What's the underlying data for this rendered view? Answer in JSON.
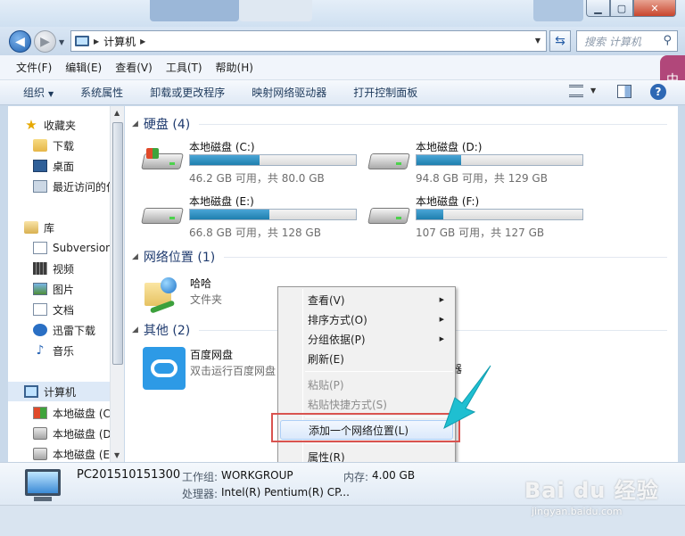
{
  "window": {
    "address_label": "计算机",
    "search_placeholder": "搜索 计算机"
  },
  "menubar": [
    "文件(F)",
    "编辑(E)",
    "查看(V)",
    "工具(T)",
    "帮助(H)"
  ],
  "toolbar": {
    "organize": "组织",
    "items": [
      "系统属性",
      "卸载或更改程序",
      "映射网络驱动器",
      "打开控制面板"
    ]
  },
  "ime_label": "中",
  "navpane": {
    "favorites": "收藏夹",
    "downloads": "下载",
    "desktop": "桌面",
    "recent": "最近访问的位",
    "libraries": "库",
    "subversion": "Subversion",
    "videos": "视频",
    "pictures": "图片",
    "documents": "文档",
    "xunlei": "迅雷下载",
    "music": "音乐",
    "computer": "计算机",
    "drive_c": "本地磁盘 (C",
    "drive_d": "本地磁盘 (D",
    "drive_e": "本地磁盘 (E"
  },
  "sections": {
    "hard_disks": "硬盘 (4)",
    "network": "网络位置 (1)",
    "other": "其他 (2)"
  },
  "drives": [
    {
      "name": "本地磁盘 (C:)",
      "free_text": "46.2 GB 可用，共 80.0 GB",
      "used_fraction": 0.42
    },
    {
      "name": "本地磁盘 (D:)",
      "free_text": "94.8 GB 可用，共 129 GB",
      "used_fraction": 0.27
    },
    {
      "name": "本地磁盘 (E:)",
      "free_text": "66.8 GB 可用，共 128 GB",
      "used_fraction": 0.48
    },
    {
      "name": "本地磁盘 (F:)",
      "free_text": "107 GB 可用，共 127 GB",
      "used_fraction": 0.16
    }
  ],
  "network_item": {
    "name": "哈哈",
    "type": "文件夹"
  },
  "other_item": {
    "name": "百度网盘",
    "desc": "双击运行百度网盘",
    "partial_text": "器"
  },
  "context_menu": {
    "view": "查看(V)",
    "sort": "排序方式(O)",
    "group": "分组依据(P)",
    "refresh": "刷新(E)",
    "paste": "粘贴(P)",
    "paste_shortcut": "粘贴快捷方式(S)",
    "add_network_location": "添加一个网络位置(L)",
    "properties": "属性(R)"
  },
  "details": {
    "pc_name": "PC201510151300",
    "workgroup_label": "工作组:",
    "workgroup": "WORKGROUP",
    "memory_label": "内存:",
    "memory": "4.00 GB",
    "cpu_label": "处理器:",
    "cpu": "Intel(R) Pentium(R) CP..."
  },
  "watermark": {
    "text": "Bai du 经验",
    "sub": "jingyan.baidu.com"
  },
  "colors": {
    "accent_arrow": "#1fbfd1",
    "highlight_box": "#d9534f",
    "drive_bar": "#1e7fae"
  }
}
